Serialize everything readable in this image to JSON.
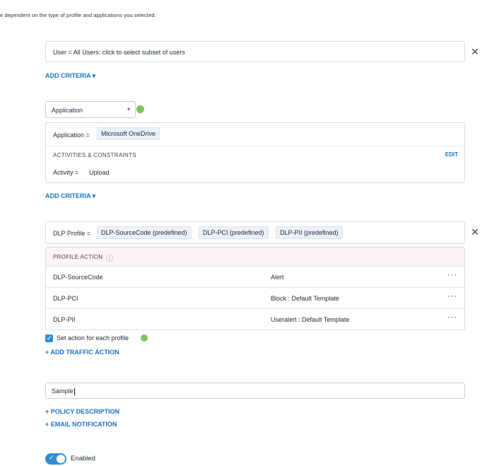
{
  "intro_text": "e dependent on the type of profile and applications you selected.",
  "user_criteria": {
    "text": "User = All Users: click to select subset of users",
    "close": "✕"
  },
  "add_criteria_1": "ADD CRITERIA ▾",
  "application_select": {
    "value": "Application",
    "caret": "▾"
  },
  "application_box": {
    "label": "Application =",
    "chip": "Microsoft OneDrive",
    "section_title": "ACTIVITIES & CONSTRAINTS",
    "edit": "EDIT",
    "activity_label": "Activity =",
    "activity_value": "Upload"
  },
  "add_criteria_2": "ADD CRITERIA ▾",
  "dlp_profile": {
    "label": "DLP Profile =",
    "chips": [
      "DLP-SourceCode (predefined)",
      "DLP-PCI (predefined)",
      "DLP-PII (predefined)"
    ],
    "close": "✕"
  },
  "profile_action": {
    "header": "PROFILE ACTION",
    "info_icon": "ⓘ",
    "rows": [
      {
        "name": "DLP-SourceCode",
        "action": "Alert",
        "menu": "···"
      },
      {
        "name": "DLP-PCI",
        "action": "Block : Default Template",
        "menu": "···"
      },
      {
        "name": "DLP-PII",
        "action": "Useralert : Default Template",
        "menu": "···"
      }
    ]
  },
  "set_action_checkbox": {
    "label": "Set action for each profile",
    "checked": true,
    "check": "✓"
  },
  "add_traffic_action": "+ ADD TRAFFIC ACTION",
  "policy_name_input": {
    "value": "Sample"
  },
  "policy_description_link": "+ POLICY DESCRIPTION",
  "email_notification_link": "+ EMAIL NOTIFICATION",
  "enabled_toggle": {
    "label": "Enabled",
    "on": true,
    "check": "✓"
  },
  "colors": {
    "accent": "#2e8fd6",
    "link": "#1a74c4",
    "status_green": "#7cc45f"
  }
}
